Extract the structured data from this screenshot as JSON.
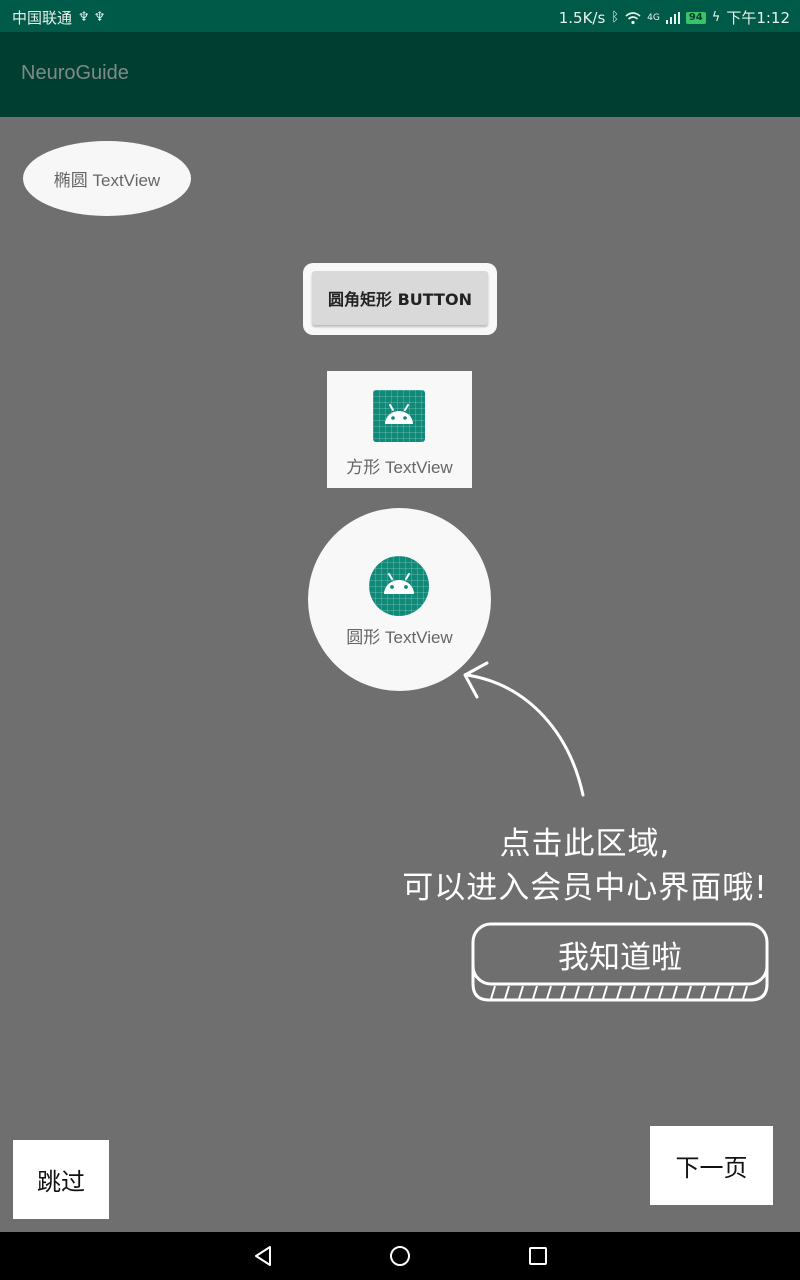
{
  "status_bar": {
    "carrier": "中国联通",
    "usb_icons": "♆ ♆",
    "net_speed": "1.5K/s",
    "signal_label": "4G",
    "battery": "94",
    "time": "下午1:12"
  },
  "app_bar": {
    "title": "NeuroGuide"
  },
  "shapes": {
    "ellipse_label": "椭圆 TextView",
    "round_button_label": "圆角矩形 BUTTON",
    "square_label": "方形 TextView",
    "circle_label": "圆形 TextView"
  },
  "guide": {
    "line1": "点击此区域,",
    "line2": "可以进入会员中心界面哦!",
    "got_it": "我知道啦"
  },
  "bottom": {
    "skip": "跳过",
    "next": "下一页"
  },
  "colors": {
    "status_bar": "#005a48",
    "app_bar": "#003e32",
    "overlay": "#6f6f6f",
    "icon_teal": "#0f8a78"
  },
  "icons": {
    "app_icon": "android-icon",
    "nav_back": "back-triangle-icon",
    "nav_home": "home-circle-icon",
    "nav_recent": "recent-square-icon"
  }
}
